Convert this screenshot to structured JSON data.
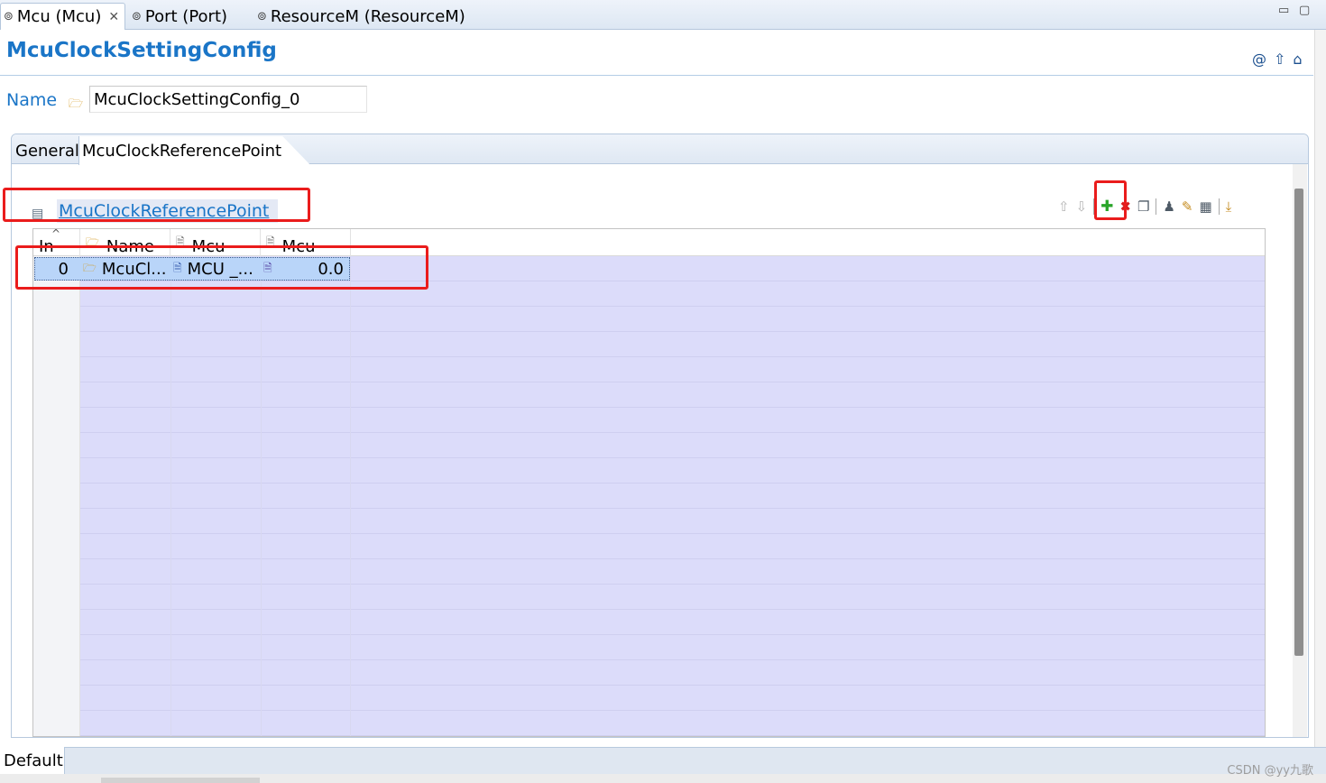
{
  "editor_tabs": [
    {
      "label": "Mcu (Mcu)",
      "active": true,
      "closable": true,
      "icon": "module-icon"
    },
    {
      "label": "Port (Port)",
      "active": false,
      "icon": "module-icon"
    },
    {
      "label": "ResourceM (ResourceM)",
      "active": false,
      "icon": "module-icon"
    }
  ],
  "window_controls": {
    "minimize": "▭",
    "maximize": "▢"
  },
  "page_title": "McuClockSettingConfig",
  "title_icons": [
    "at-sign-icon",
    "up-arrow-icon",
    "home-icon"
  ],
  "name_field": {
    "label": "Name",
    "value": "McuClockSettingConfig_0",
    "icon": "folder-icon"
  },
  "form_tabs": [
    {
      "label": "General",
      "active": false
    },
    {
      "label": "McuClockReferencePoint",
      "active": true
    }
  ],
  "table_title": "McuClockReferencePoint",
  "toolbar": [
    "move-up-icon",
    "move-down-icon",
    "add-icon",
    "delete-icon",
    "copy-icon",
    "user-icon",
    "edit-icon",
    "table-edit-icon",
    "export-icon"
  ],
  "table": {
    "columns": [
      {
        "label": "In",
        "icon": ""
      },
      {
        "label": "Name",
        "icon": "folder-icon"
      },
      {
        "label": "Mcu",
        "icon": "doc-icon"
      },
      {
        "label": "Mcu",
        "icon": "doc-icon"
      }
    ],
    "rows": [
      {
        "index": "0",
        "name": "McuCl...",
        "ref": "MCU _...",
        "value": "0.0"
      }
    ]
  },
  "footer_tab": "Default",
  "watermark": "CSDN @yy九歌",
  "colors": {
    "accent": "#1a75c7",
    "selection": "#b9d5f9",
    "grid": "#dcdcfa",
    "highlight": "#ea1c1c"
  }
}
